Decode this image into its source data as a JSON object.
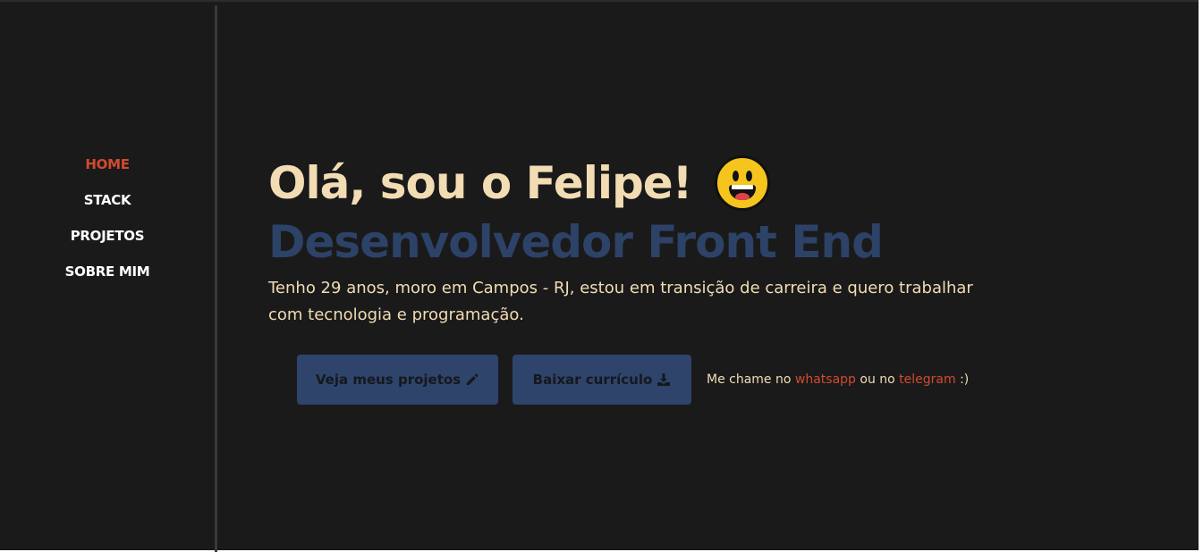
{
  "nav": {
    "items": [
      {
        "label": "HOME",
        "active": true
      },
      {
        "label": "STACK",
        "active": false
      },
      {
        "label": "PROJETOS",
        "active": false
      },
      {
        "label": "SOBRE MIM",
        "active": false
      }
    ]
  },
  "hero": {
    "greeting": "Olá, sou o Felipe!",
    "greeting_emoji": "grinning-face-icon",
    "role": "Desenvolvedor Front End",
    "bio": "Tenho 29 anos, moro em Campos - RJ, estou em transição de carreira e quero trabalhar com tecnologia e programação."
  },
  "actions": {
    "projects_label": "Veja meus projetos",
    "projects_icon": "pencil-icon",
    "cv_label": "Baixar currículo",
    "cv_icon": "download-icon"
  },
  "contact": {
    "prefix": "Me chame no",
    "whatsapp": "whatsapp",
    "middle": "ou no",
    "telegram": "telegram",
    "suffix": ":)"
  },
  "colors": {
    "background": "#1a1a1b",
    "accent": "#d34a2e",
    "cream": "#f2dcb3",
    "navy": "#2d4267"
  }
}
